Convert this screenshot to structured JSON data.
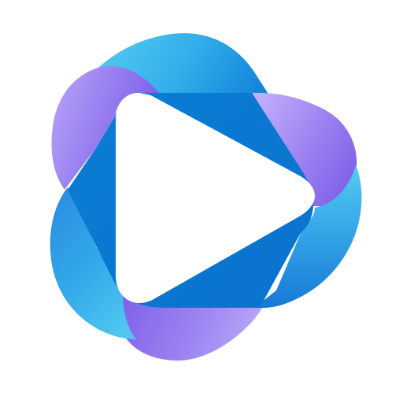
{
  "app": {
    "title": ""
  },
  "icon": {
    "semantic_name": "play-logo-icon",
    "background_color": "#ffffff",
    "colors": {
      "blue_light": "#4cc7ef",
      "blue_mid": "#1f93e3",
      "blue_dark": "#0677d1",
      "purple_light": "#b8a4f8",
      "purple_mid": "#9a7ef0",
      "purple_dark": "#7d5ce8",
      "play_fill": "#ffffff"
    }
  }
}
